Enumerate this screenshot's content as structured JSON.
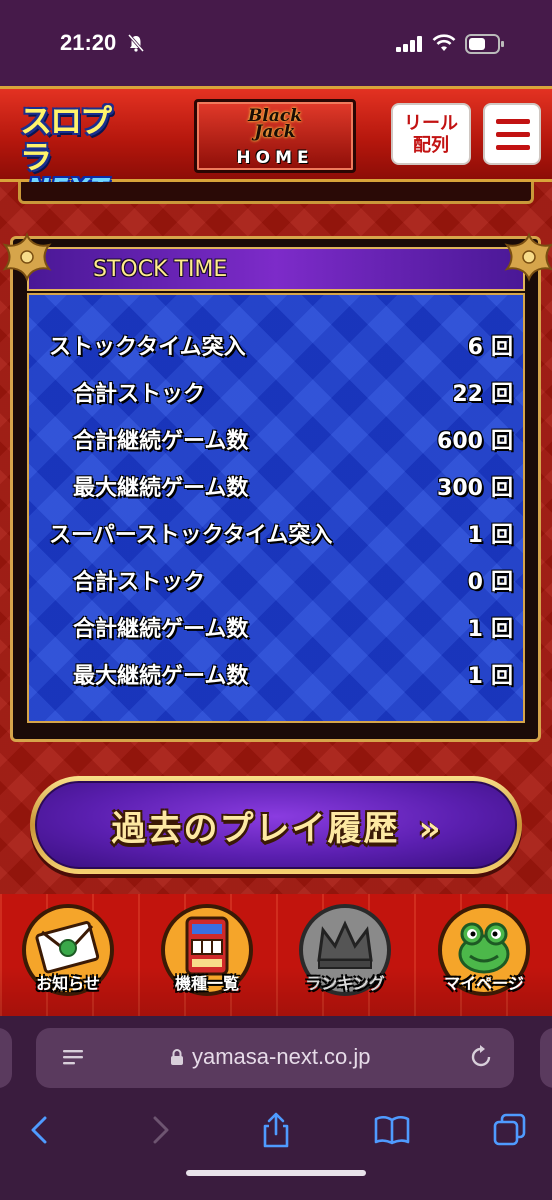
{
  "status_bar": {
    "time": "21:20"
  },
  "header": {
    "logo_top": "スロプラ",
    "logo_bottom": "NEXT",
    "home_logo_line1": "Black",
    "home_logo_line2": "Jack",
    "home_label": "HOME",
    "reel_label_line1": "リール",
    "reel_label_line2": "配列"
  },
  "panel": {
    "title": "STOCK TIME",
    "unit": "回",
    "rows": [
      {
        "label": "ストックタイム突入",
        "value": "6",
        "indent": false
      },
      {
        "label": "合計ストック",
        "value": "22",
        "indent": true
      },
      {
        "label": "合計継続ゲーム数",
        "value": "600",
        "indent": true
      },
      {
        "label": "最大継続ゲーム数",
        "value": "300",
        "indent": true
      },
      {
        "label": "スーパーストックタイム突入",
        "value": "1",
        "indent": false
      },
      {
        "label": "合計ストック",
        "value": "0",
        "indent": true
      },
      {
        "label": "合計継続ゲーム数",
        "value": "1",
        "indent": true
      },
      {
        "label": "最大継続ゲーム数",
        "value": "1",
        "indent": true
      }
    ]
  },
  "history_button": {
    "label": "過去のプレイ履歴",
    "chevron": "»"
  },
  "bottom_nav": {
    "items": [
      {
        "label": "お知らせ",
        "icon": "envelope-icon",
        "enabled": true
      },
      {
        "label": "機種一覧",
        "icon": "slot-machine-icon",
        "enabled": true
      },
      {
        "label": "ランキング",
        "icon": "crown-icon",
        "enabled": false
      },
      {
        "label": "マイページ",
        "icon": "frog-icon",
        "enabled": true
      }
    ]
  },
  "safari": {
    "url": "yamasa-next.co.jp"
  },
  "colors": {
    "header_red": "#c21212",
    "panel_blue": "#1f3ec6",
    "panel_header_purple": "#7d2bc9",
    "gold": "#d6a54b",
    "stat_text": "#ffffff"
  }
}
